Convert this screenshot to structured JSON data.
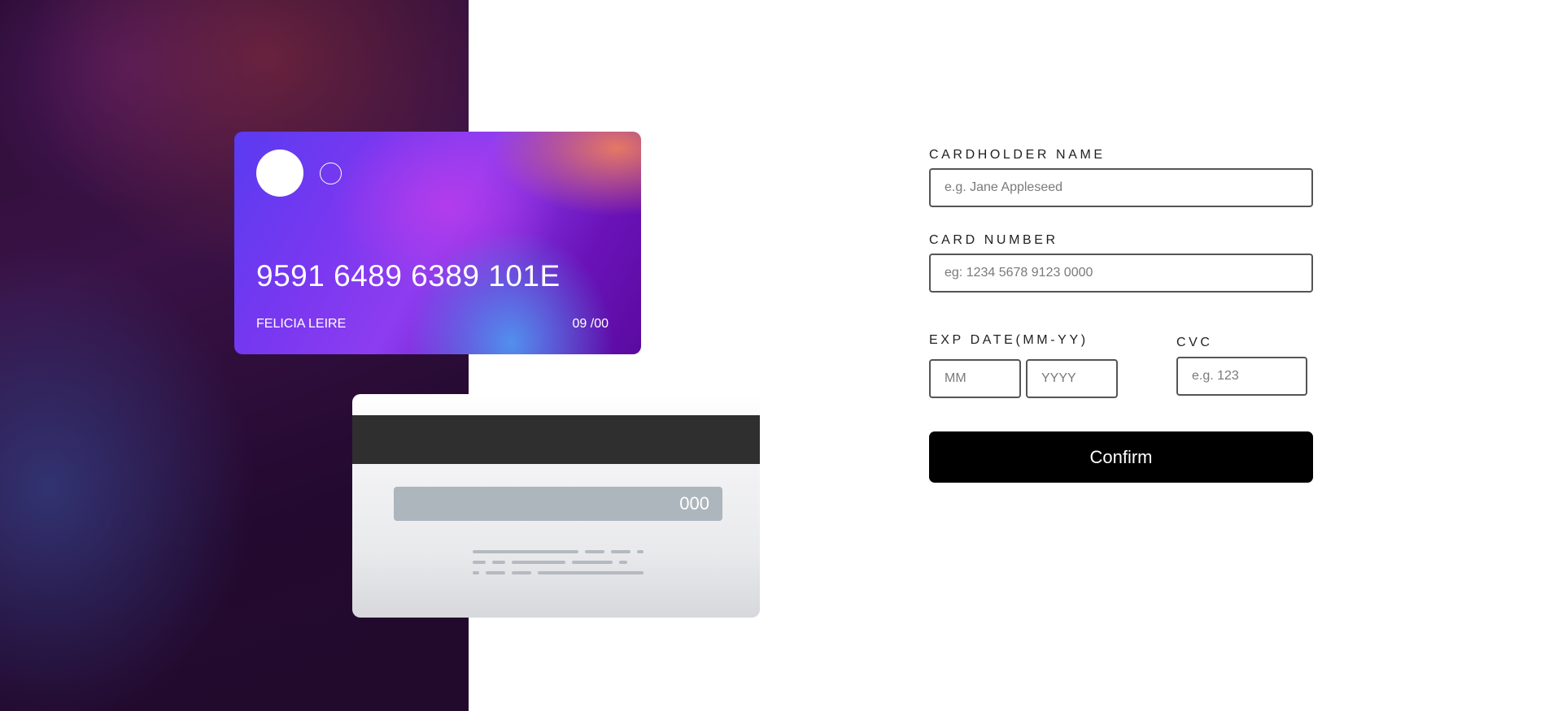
{
  "card_front": {
    "number": "9591 6489 6389 101E",
    "name": "FELICIA LEIRE",
    "exp": "09 /00"
  },
  "card_back": {
    "cvc": "000"
  },
  "form": {
    "cardholder_label": "CARDHOLDER NAME",
    "cardholder_placeholder": "e.g. Jane Appleseed",
    "number_label": "CARD NUMBER",
    "number_placeholder": "eg: 1234 5678 9123 0000",
    "exp_label": "EXP DATE(MM-YY)",
    "month_placeholder": "MM",
    "year_placeholder": "YYYY",
    "cvc_label": "CVC",
    "cvc_placeholder": "e.g. 123",
    "confirm_label": "Confirm"
  },
  "colors": {
    "button_bg": "#000000",
    "input_border": "#555555"
  }
}
